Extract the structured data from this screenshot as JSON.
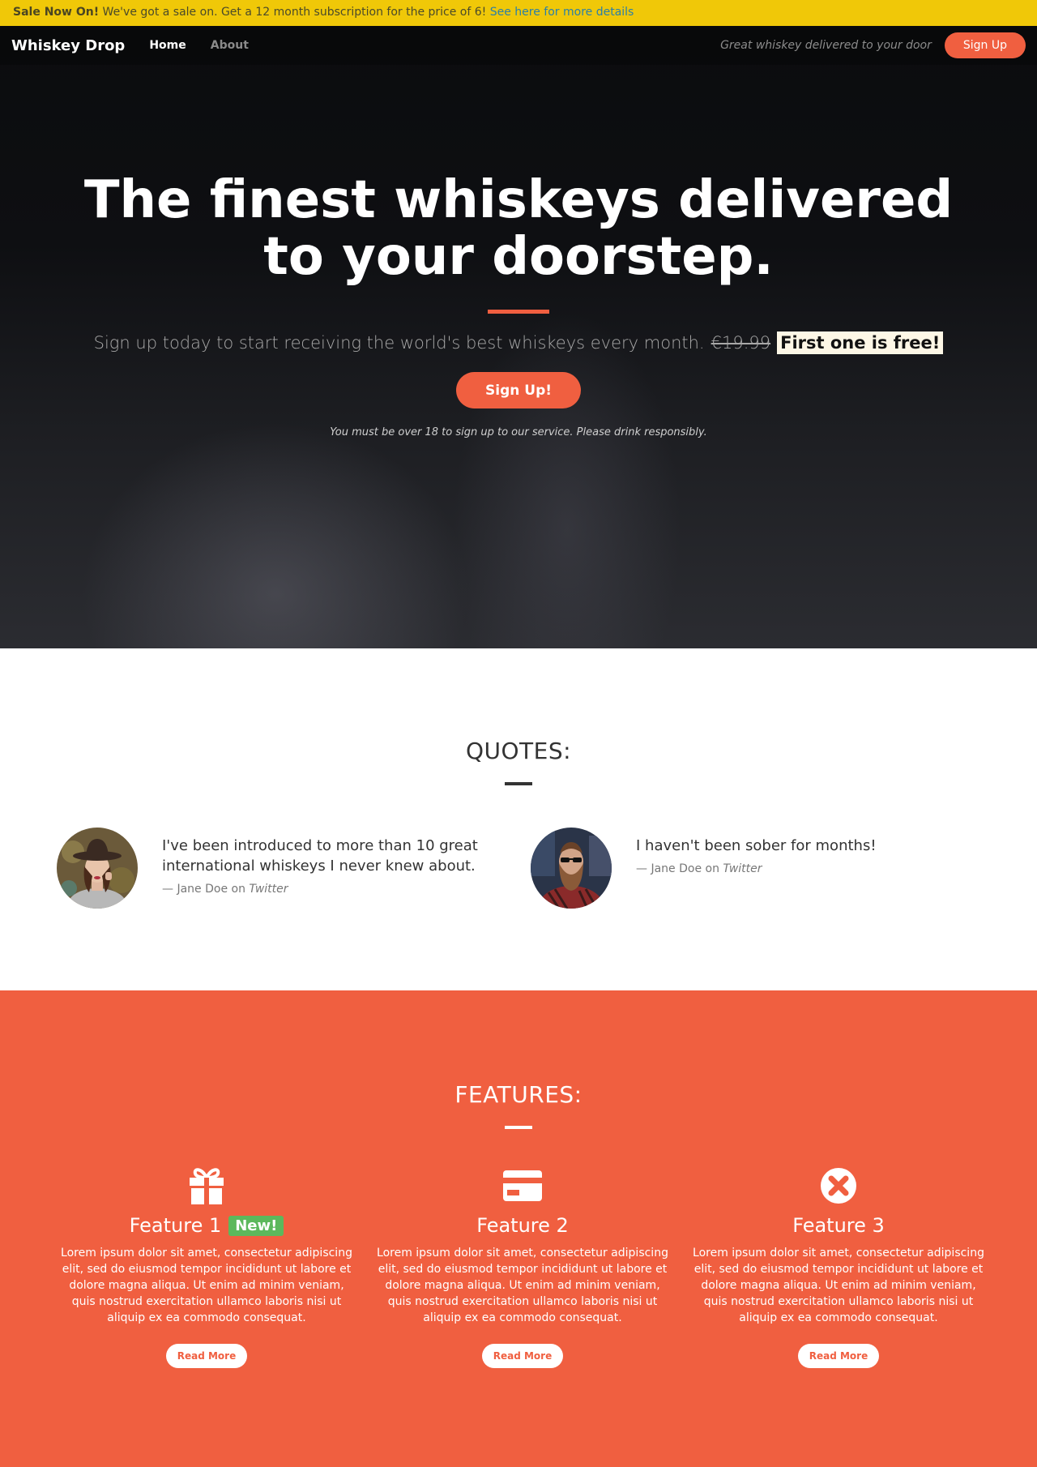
{
  "sale_banner": {
    "headline": "Sale Now On!",
    "message": " We've got a sale on. Get a 12 month subscription for the price of 6! ",
    "link": "See here for more details"
  },
  "nav": {
    "brand": "Whiskey Drop",
    "links": [
      "Home",
      "About"
    ],
    "active": "Home",
    "tagline": "Great whiskey delivered to your door",
    "signup_label": "Sign Up"
  },
  "hero": {
    "title": "The finest whiskeys delivered to your doorstep.",
    "subtitle": "Sign up today to start receiving the world's best whiskeys every month.",
    "old_price": "€19.99",
    "offer": "First one is free!",
    "signup_label": "Sign Up!",
    "note": "You must be over 18 to sign up to our service. Please drink responsibly."
  },
  "quotes": {
    "title": "QUOTES:",
    "items": [
      {
        "text": "I've been introduced to more than 10 great international whiskeys I never knew about.",
        "author": "Jane Doe",
        "on": "on",
        "source": "Twitter"
      },
      {
        "text": "I haven't been sober for months!",
        "author": "Jane Doe",
        "on": "on",
        "source": "Twitter"
      }
    ]
  },
  "features": {
    "title": "FEATURES:",
    "items": [
      {
        "icon": "gift-icon",
        "title": "Feature 1",
        "badge": "New!",
        "text": "Lorem ipsum dolor sit amet, consectetur adipiscing elit, sed do eiusmod tempor incididunt ut labore et dolore magna aliqua. Ut enim ad minim veniam, quis nostrud exercitation ullamco laboris nisi ut aliquip ex ea commodo consequat.",
        "button": "Read More"
      },
      {
        "icon": "credit-card-icon",
        "title": "Feature 2",
        "text": "Lorem ipsum dolor sit amet, consectetur adipiscing elit, sed do eiusmod tempor incididunt ut labore et dolore magna aliqua. Ut enim ad minim veniam, quis nostrud exercitation ullamco laboris nisi ut aliquip ex ea commodo consequat.",
        "button": "Read More"
      },
      {
        "icon": "close-circle-icon",
        "title": "Feature 3",
        "text": "Lorem ipsum dolor sit amet, consectetur adipiscing elit, sed do eiusmod tempor incididunt ut labore et dolore magna aliqua. Ut enim ad minim veniam, quis nostrud exercitation ullamco laboris nisi ut aliquip ex ea commodo consequat.",
        "button": "Read More"
      }
    ]
  },
  "colors": {
    "accent": "#f05f40",
    "banner": "#f0c808",
    "badge_green": "#5cb85c",
    "link": "#2a7fa8"
  }
}
